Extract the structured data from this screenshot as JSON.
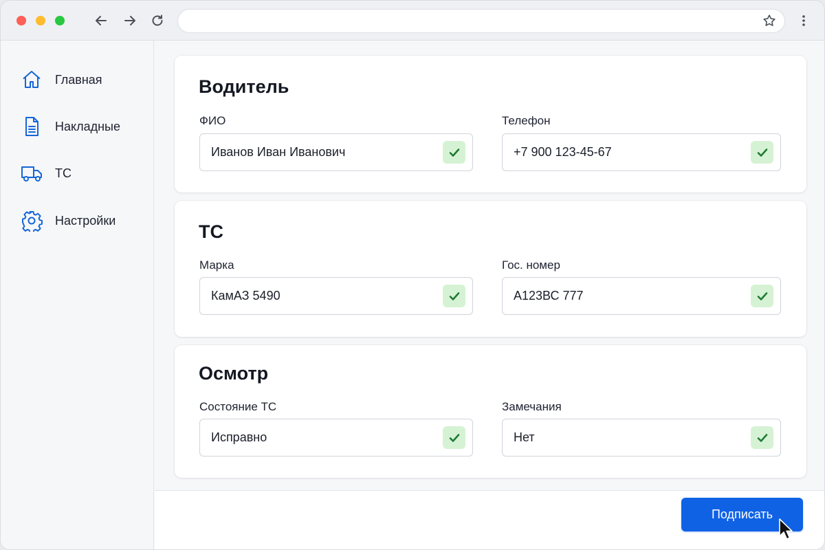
{
  "browser": {
    "url": ""
  },
  "sidebar": {
    "items": [
      {
        "label": "Главная",
        "icon": "home-icon"
      },
      {
        "label": "Накладные",
        "icon": "document-icon"
      },
      {
        "label": "ТС",
        "icon": "truck-icon"
      },
      {
        "label": "Настройки",
        "icon": "gear-icon"
      }
    ]
  },
  "sections": [
    {
      "title": "Водитель",
      "fields": [
        {
          "label": "ФИО",
          "value": "Иванов Иван Иванович",
          "valid": true
        },
        {
          "label": "Телефон",
          "value": "+7 900 123-45-67",
          "valid": true
        }
      ]
    },
    {
      "title": "ТС",
      "fields": [
        {
          "label": "Марка",
          "value": "КамАЗ 5490",
          "valid": true
        },
        {
          "label": "Гос. номер",
          "value": "А123ВС 777",
          "valid": true
        }
      ]
    },
    {
      "title": "Осмотр",
      "fields": [
        {
          "label": "Состояние ТС",
          "value": "Исправно",
          "valid": true
        },
        {
          "label": "Замечания",
          "value": "Нет",
          "valid": true
        }
      ]
    }
  ],
  "footer": {
    "sign_label": "Подписать"
  },
  "colors": {
    "accent": "#1062e5",
    "valid_bg": "#d6f2d4",
    "valid_check": "#1f7a34",
    "sidebar_icon": "#1565d8"
  }
}
